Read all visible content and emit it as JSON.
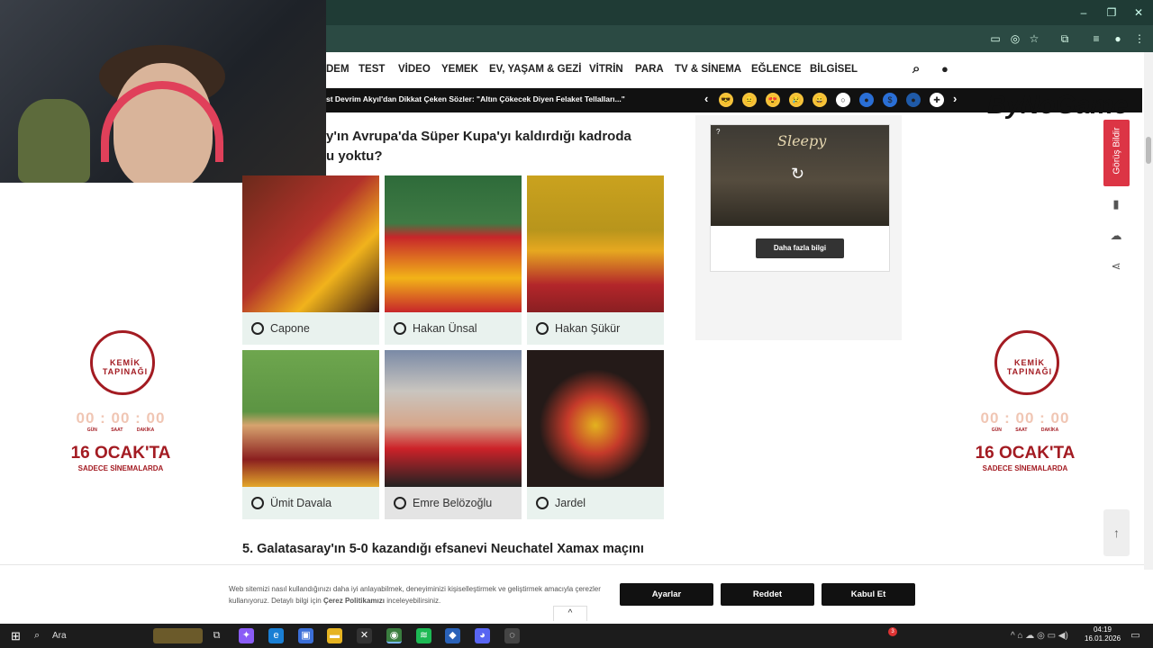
{
  "window": {
    "minimize": "–",
    "restore": "❐",
    "close": "✕"
  },
  "toolbar": {
    "icons": [
      "cast-icon",
      "eye-off-icon",
      "star-icon",
      "extensions-icon",
      "media-icon",
      "profile-icon",
      "menu-icon"
    ]
  },
  "nav": {
    "items": [
      "DEM",
      "TEST",
      "VİDEO",
      "YEMEK",
      "EV, YAŞAM & GEZİ",
      "VİTRİN",
      "PARA",
      "TV & SİNEMA",
      "EĞLENCE",
      "BİLGİSEL"
    ]
  },
  "ticker": {
    "text": "st Devrim Akyıl'dan Dikkat Çeken Sözler: \"Altın Çökecek Diyen Felaket Tellalları...\"",
    "prev": "‹",
    "next": "›"
  },
  "overlay_logo": "ByNoGame",
  "question": {
    "title_line1": "y'ın Avrupa'da Süper Kupa'yı kaldırdığı kadroda",
    "title_line2": "u yoktu?",
    "options": [
      {
        "name": "Capone"
      },
      {
        "name": "Hakan Ünsal"
      },
      {
        "name": "Hakan Şükür"
      },
      {
        "name": "Ümit Davala"
      },
      {
        "name": "Emre Belözoğlu"
      },
      {
        "name": "Jardel"
      }
    ],
    "next_title": "5. Galatasaray'ın 5-0 kazandığı efsanevi Neuchatel Xamax maçını"
  },
  "ad": {
    "brand": "Sleepy",
    "cta": "Daha fazla bilgi",
    "info": "?",
    "replay": "↻"
  },
  "promo": {
    "emblem": "KEMİK TAPINAĞI",
    "timer": "00 : 00 : 00",
    "units": "GÜN SAAT DAKİKA",
    "date": "16 OCAK'TA",
    "sub": "SADECE SİNEMALARDA"
  },
  "side": {
    "feedback": "Görüş Bildir",
    "scroll_top": "↑"
  },
  "cookie": {
    "text_before": "Web sitemizi nasıl kullandığınızı daha iyi anlayabilmek, deneyiminizi kişiselleştirmek ve geliştirmek amacıyla çerezler kullanıyoruz. Detaylı bilgi için ",
    "link": "Çerez Politikamızı",
    "text_after": " inceleyebilirsiniz.",
    "settings": "Ayarlar",
    "reject": "Reddet",
    "accept": "Kabul Et",
    "toggle": "^"
  },
  "taskbar": {
    "search": "Ara",
    "time": "04:19",
    "date": "16.01.2026",
    "badge": "3"
  },
  "colors": {
    "brand_red": "#dc3545",
    "card_bg": "#e9f2ee",
    "chrome": "#2b4a43",
    "promo_red": "#a31b22"
  }
}
